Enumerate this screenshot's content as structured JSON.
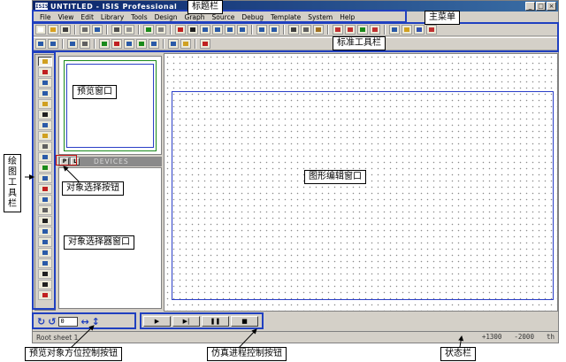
{
  "window": {
    "app_icon": "ISIS",
    "title": "UNTITLED - ISIS Professional",
    "controls": [
      "_",
      "□",
      "×"
    ]
  },
  "menu": [
    "File",
    "View",
    "Edit",
    "Library",
    "Tools",
    "Design",
    "Graph",
    "Source",
    "Debug",
    "Template",
    "System",
    "Help"
  ],
  "devices": {
    "btn_p": "P",
    "btn_l": "L",
    "label": "DEVICES"
  },
  "rotation": {
    "rotate_cw_icon": "rotate-cw-icon",
    "rotate_ccw_icon": "rotate-ccw-icon",
    "angle": "0",
    "mirror_h": "↔",
    "mirror_v": "↕"
  },
  "simulation": {
    "play": "▶",
    "step": "▶|",
    "pause": "❚❚",
    "stop": "■"
  },
  "status": {
    "sheet": "Root sheet 1",
    "x": "+1300",
    "y": "-2000",
    "unit": "th"
  },
  "annotations": {
    "title_bar": "标题栏",
    "main_menu": "主菜单",
    "standard_toolbar": "标准工具栏",
    "preview_window": "预览窗口",
    "object_select_button": "对象选择按钮",
    "object_selector_window": "对象选择器窗口",
    "graphics_edit_window": "图形编辑窗口",
    "drawing_toolbar": "绘图工具栏",
    "preview_orientation_control": "预览对象方位控制按钮",
    "simulation_control": "仿真进程控制按钮",
    "status_bar": "状态栏"
  },
  "colors": {
    "title_bar": "#0a246a",
    "sheet_border": "#2b3fc7",
    "preview_border": "#1a8a1a",
    "highlight": "#2040c0"
  }
}
